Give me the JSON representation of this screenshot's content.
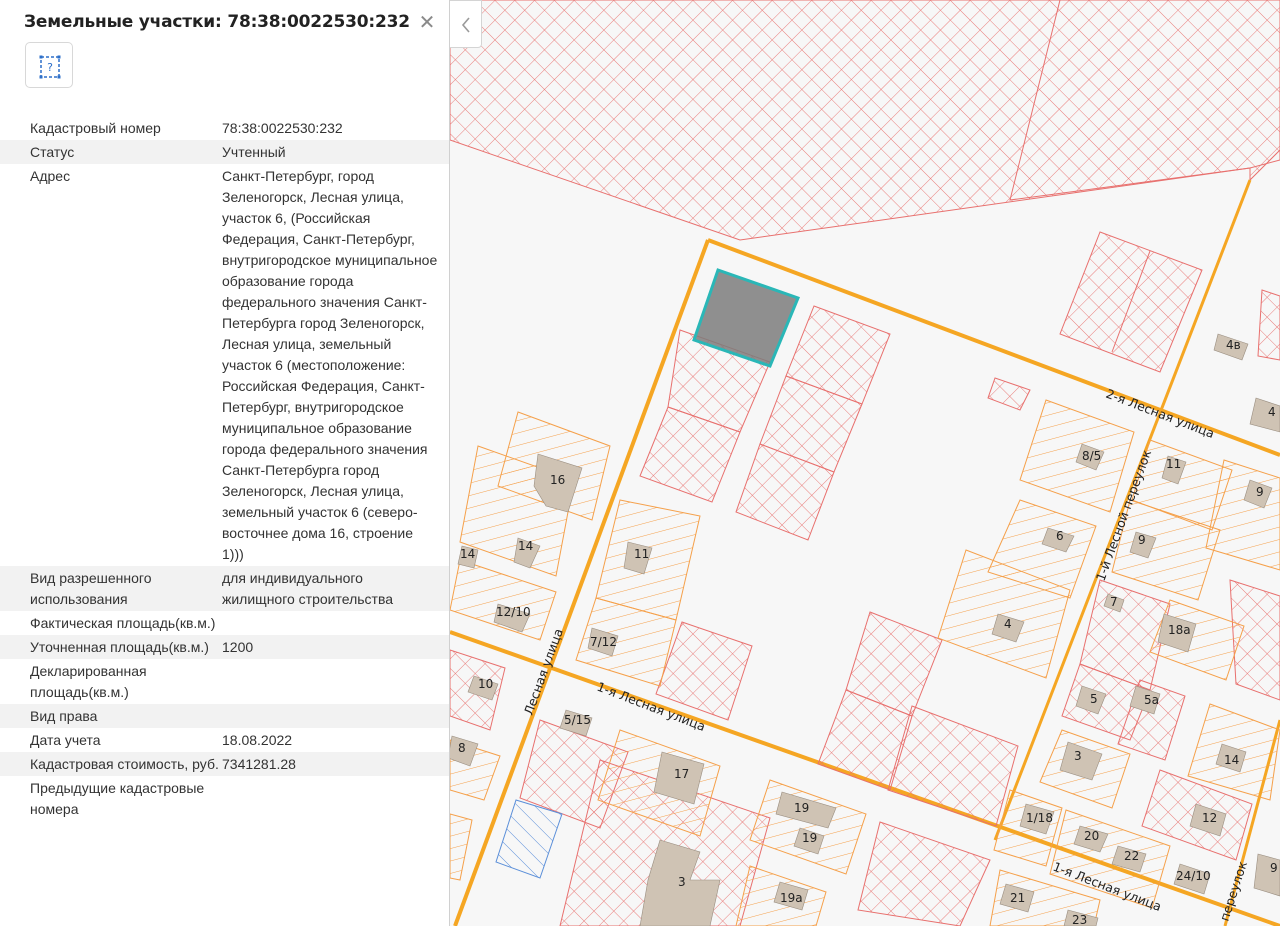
{
  "panel": {
    "title": "Земельные участки: 78:38:0022530:232",
    "close_icon": "close-icon",
    "tool_icon": "parcel-info-icon",
    "rows": [
      {
        "key": "Кадастровый номер",
        "value": "78:38:0022530:232"
      },
      {
        "key": "Статус",
        "value": "Учтенный"
      },
      {
        "key": "Адрес",
        "value": "Санкт-Петербург, город Зеленогорск, Лесная улица, участок 6, (Российская Федерация, Санкт-Петербург, внутригородское муниципальное образование города федерального значения Санкт-Петербурга город Зеленогорск, Лесная улица, земельный участок 6 (местоположение: Российская Федерация, Санкт-Петербург, внутригородское муниципальное образование города федерального значения Санкт-Петербурга город Зеленогорск, Лесная улица, земельный участок 6 (северо-восточнее дома 16, строение 1)))"
      },
      {
        "key": "Вид разрешенного использования",
        "value": "для индивидуального жилищного строительства"
      },
      {
        "key": "Фактическая площадь(кв.м.)",
        "value": ""
      },
      {
        "key": "Уточненная площадь(кв.м.)",
        "value": "1200"
      },
      {
        "key": "Декларированная площадь(кв.м.)",
        "value": ""
      },
      {
        "key": "Вид права",
        "value": ""
      },
      {
        "key": "Дата учета",
        "value": "18.08.2022"
      },
      {
        "key": "Кадастровая стоимость, руб.",
        "value": "7341281.28"
      },
      {
        "key": "Предыдущие кадастровые номера",
        "value": ""
      }
    ]
  },
  "collapse_icon": "chevron-left-icon",
  "map": {
    "colors": {
      "parcel_hatch": "#e8706e",
      "building_zone": "#f5a04a",
      "road": "#f5a623",
      "selected_outline": "#2ab7b7",
      "selected_fill": "#7d7d7d",
      "building_fill": "#cfc3b4",
      "special_hatch": "#5b8fd9"
    },
    "streets": [
      "2-я Лесная улица",
      "1-й Лесной переулок",
      "Лесная улица",
      "1-я Лесная улица",
      "1-я Лесная улица",
      "переулок"
    ],
    "house_labels": [
      "4в",
      "4",
      "8/5",
      "11",
      "9",
      "16",
      "6",
      "9",
      "14",
      "14",
      "11",
      "7",
      "18а",
      "4",
      "12/10",
      "7/12",
      "10",
      "5",
      "5а",
      "8",
      "5/15",
      "3",
      "14",
      "17",
      "19",
      "19",
      "1/18",
      "20",
      "12",
      "22",
      "24/10",
      "9",
      "3",
      "19а",
      "21",
      "23"
    ]
  }
}
